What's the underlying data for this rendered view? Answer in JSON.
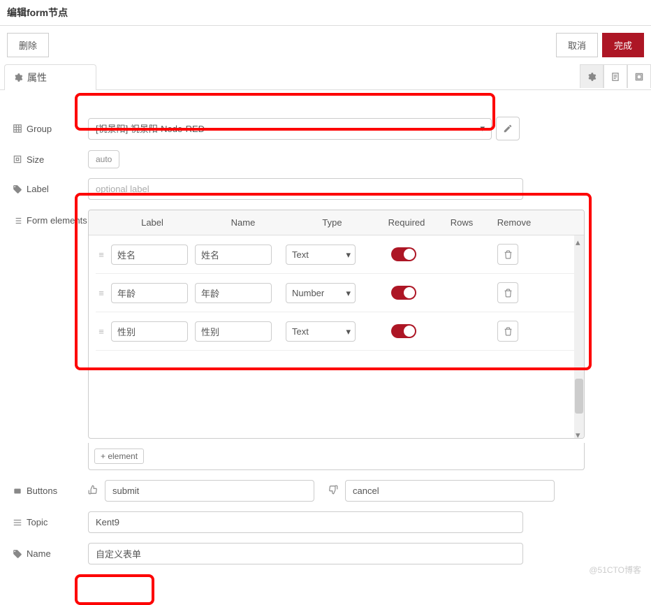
{
  "header": {
    "title": "编辑form节点"
  },
  "actions": {
    "delete": "删除",
    "cancel": "取消",
    "done": "完成"
  },
  "tabs": {
    "properties": "属性"
  },
  "fields": {
    "group": {
      "label": "Group",
      "value": "[祝景阳] 祝景阳-Node-RED"
    },
    "size": {
      "label": "Size",
      "value": "auto"
    },
    "labelField": {
      "label": "Label",
      "placeholder": "optional label"
    },
    "formElements": {
      "label": "Form elements"
    },
    "buttons": {
      "label": "Buttons",
      "submit": "submit",
      "cancel": "cancel"
    },
    "topic": {
      "label": "Topic",
      "value": "Kent9"
    },
    "name": {
      "label": "Name",
      "value": "自定义表单"
    }
  },
  "elementsTable": {
    "headers": {
      "label": "Label",
      "name": "Name",
      "type": "Type",
      "required": "Required",
      "rows": "Rows",
      "remove": "Remove"
    },
    "addButton": "element",
    "rows": [
      {
        "label": "姓名",
        "name": "姓名",
        "type": "Text",
        "required": true
      },
      {
        "label": "年龄",
        "name": "年龄",
        "type": "Number",
        "required": true
      },
      {
        "label": "性别",
        "name": "性别",
        "type": "Text",
        "required": true
      }
    ]
  },
  "watermark": "@51CTO博客"
}
